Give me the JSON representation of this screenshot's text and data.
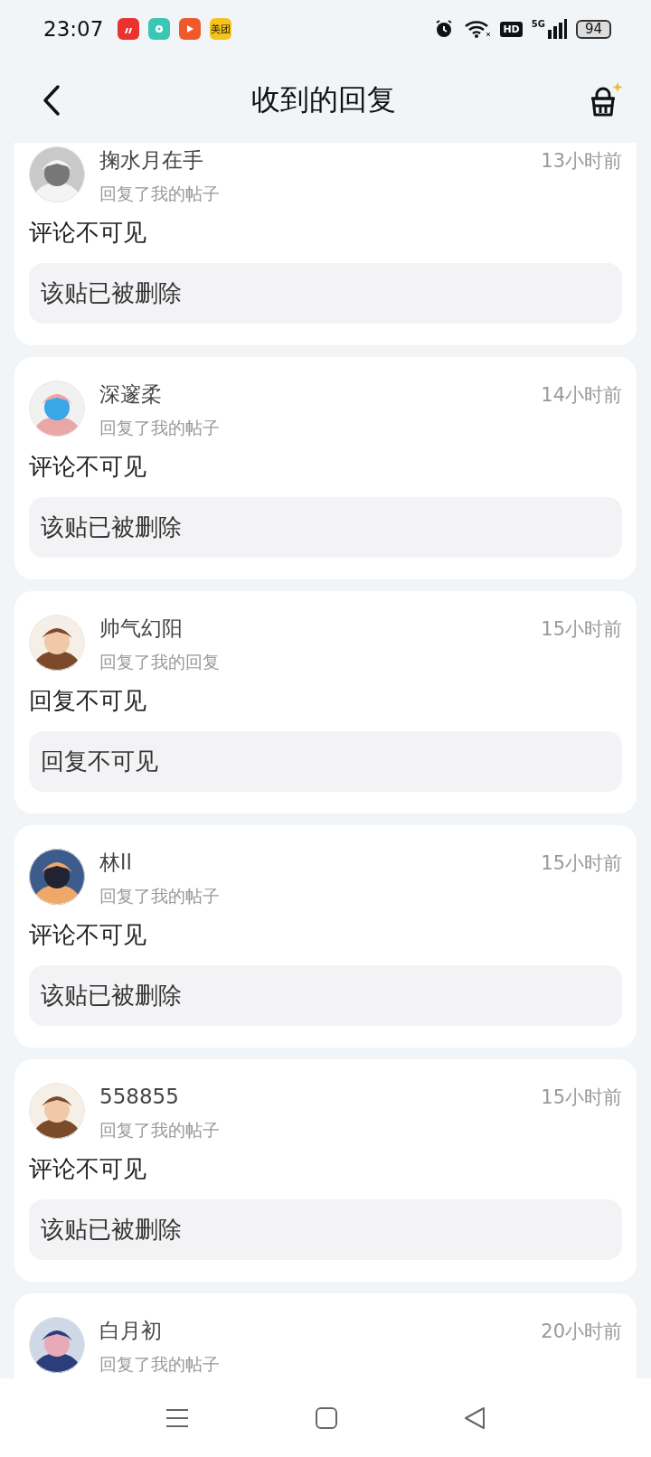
{
  "status_bar": {
    "time": "23:07",
    "app_icons": [
      {
        "kind": "bars",
        "color": "#e8332f"
      },
      {
        "kind": "disc",
        "color": "#3cc7b4"
      },
      {
        "kind": "play",
        "color": "#ef5a2a"
      },
      {
        "kind": "label",
        "color": "#f5c31b",
        "label": "美团"
      }
    ],
    "hd": "HD",
    "network": "5G",
    "battery": "94"
  },
  "header": {
    "title": "收到的回复"
  },
  "replies": [
    {
      "name": "掬水月在手",
      "action": "回复了我的帖子",
      "time": "13小时前",
      "comment": "评论不可见",
      "quote": "该贴已被删除"
    },
    {
      "name": "深邃柔",
      "action": "回复了我的帖子",
      "time": "14小时前",
      "comment": "评论不可见",
      "quote": "该贴已被删除"
    },
    {
      "name": "帅气幻阳",
      "action": "回复了我的回复",
      "time": "15小时前",
      "comment": "回复不可见",
      "quote": "回复不可见"
    },
    {
      "name": "林ll",
      "action": "回复了我的帖子",
      "time": "15小时前",
      "comment": "评论不可见",
      "quote": "该贴已被删除"
    },
    {
      "name": "558855",
      "action": "回复了我的帖子",
      "time": "15小时前",
      "comment": "评论不可见",
      "quote": "该贴已被删除"
    },
    {
      "name": "白月初",
      "action": "回复了我的帖子",
      "time": "20小时前"
    }
  ]
}
